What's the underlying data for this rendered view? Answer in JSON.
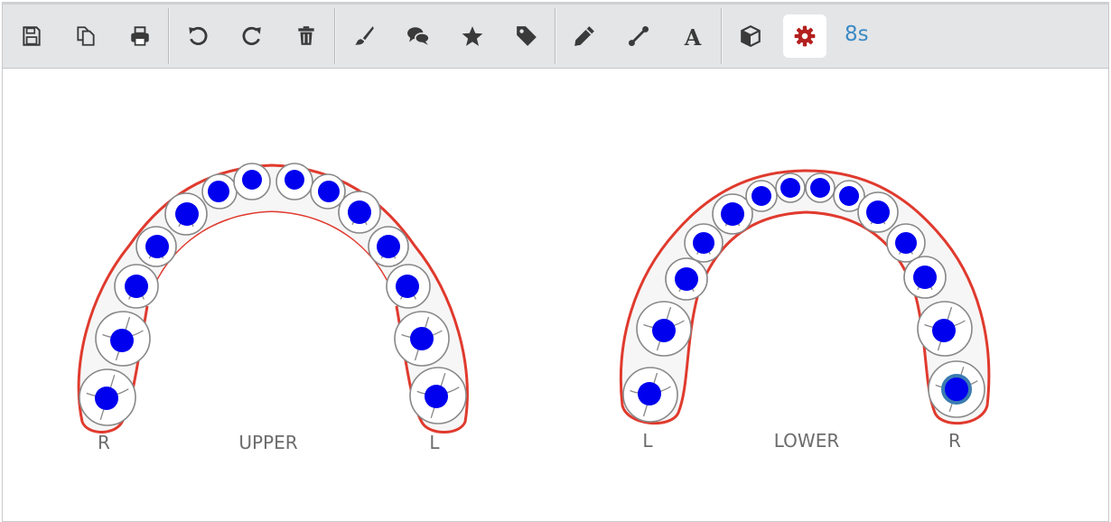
{
  "toolbar": {
    "buttons": [
      {
        "name": "save-icon",
        "title": "save"
      },
      {
        "name": "copy-icon",
        "title": "copy"
      },
      {
        "name": "print-icon",
        "title": "print"
      },
      {
        "name": "undo-icon",
        "title": "undo"
      },
      {
        "name": "redo-icon",
        "title": "redo"
      },
      {
        "name": "trash-icon",
        "title": "delete"
      },
      {
        "name": "brush-icon",
        "title": "brush"
      },
      {
        "name": "comments-icon",
        "title": "comments"
      },
      {
        "name": "star-icon",
        "title": "star"
      },
      {
        "name": "tag-icon",
        "title": "tag"
      },
      {
        "name": "pencil-icon",
        "title": "pencil"
      },
      {
        "name": "line-tool-icon",
        "title": "line"
      },
      {
        "name": "text-tool-icon",
        "title": "text"
      },
      {
        "name": "cube-icon",
        "title": "3d view"
      },
      {
        "name": "gear-icon",
        "title": "settings",
        "active": true
      }
    ],
    "timer": "8s"
  },
  "chart": {
    "upper": {
      "label": "UPPER",
      "left_side": "R",
      "right_side": "L"
    },
    "lower": {
      "label": "LOWER",
      "left_side": "L",
      "right_side": "R"
    }
  },
  "colors": {
    "marker": "#0000ee",
    "arch_outline": "#e03a2e",
    "tooth_outline": "#888888",
    "selected_ring": "#3a7bb0",
    "active_icon": "#b3201f"
  }
}
